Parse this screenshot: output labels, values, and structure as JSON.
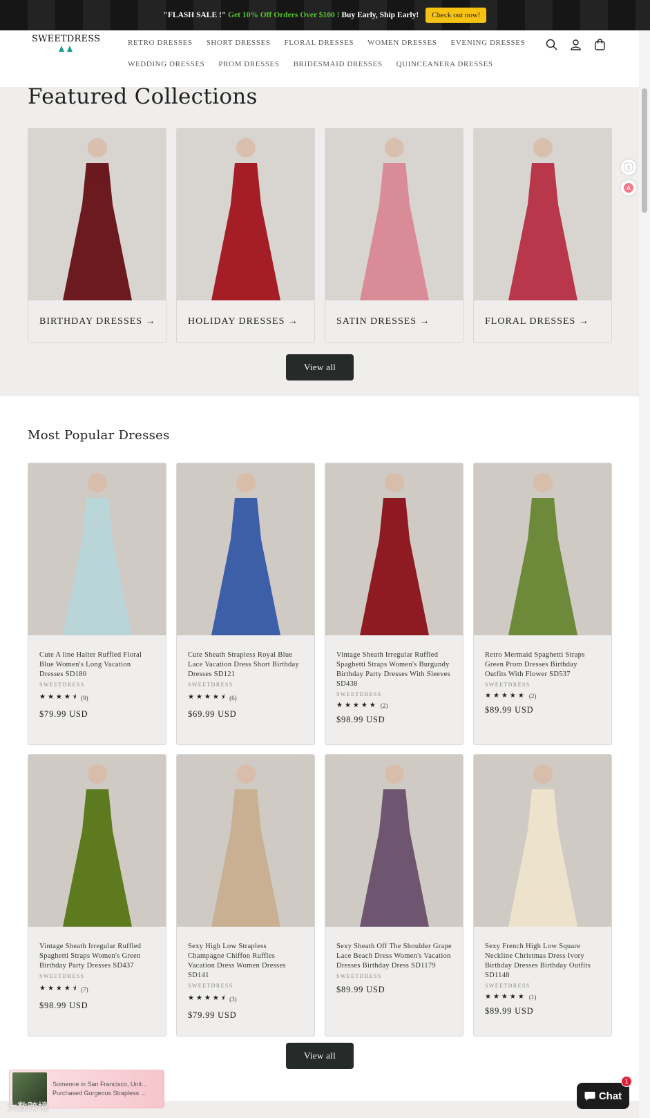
{
  "announcement": {
    "prefix": "\"FLASH SALE !\"",
    "highlight": "Get 10% Off Orders Over $100 !",
    "suffix": "Buy Early, Ship Early!",
    "button": "Check out now!"
  },
  "header": {
    "logo_text": "SWEETDRESS",
    "nav_row1": [
      "RETRO DRESSES",
      "SHORT DRESSES",
      "FLORAL DRESSES",
      "WOMEN DRESSES",
      "EVENING DRESSES"
    ],
    "nav_row2": [
      "WEDDING DRESSES",
      "PROM DRESSES",
      "BRIDESMAID DRESSES",
      "QUINCEANERA DRESSES"
    ],
    "icons": [
      "search-icon",
      "account-icon",
      "cart-icon"
    ]
  },
  "featured": {
    "title": "Featured Collections",
    "collections": [
      {
        "label": "BIRTHDAY DRESSES →",
        "color": "#6b1a1f"
      },
      {
        "label": "HOLIDAY DRESSES →",
        "color": "#a51e26"
      },
      {
        "label": "SATIN DRESSES →",
        "color": "#d98c98"
      },
      {
        "label": "FLORAL DRESSES →",
        "color": "#b8374a"
      }
    ],
    "view_all": "View all"
  },
  "popular": {
    "title": "Most Popular Dresses",
    "products": [
      {
        "title": "Cute A line Halter Ruffled Floral Blue Women's Long Vacation Dresses SD180",
        "vendor": "SWEETDRESS",
        "stars": "★★★★⯨",
        "count": "(9)",
        "price": "$79.99 USD",
        "color": "#b9d5d8"
      },
      {
        "title": "Cute Sheath Strapless Royal Blue Lace Vacation Dress Short Birthday Dresses SD121",
        "vendor": "SWEETDRESS",
        "stars": "★★★★⯨",
        "count": "(6)",
        "price": "$69.99 USD",
        "color": "#3c5fa8"
      },
      {
        "title": "Vintage Sheath Irregular Ruffled Spaghetti Straps Women's Burgundy Birthday Party Dresses With Sleeves SD438",
        "vendor": "SWEETDRESS",
        "stars": "★★★★★",
        "count": "(2)",
        "price": "$98.99 USD",
        "color": "#8e1a22"
      },
      {
        "title": "Retro Mermaid Spaghetti Straps Green Prom Dresses Birthday Outfits With Flower SD537",
        "vendor": "SWEETDRESS",
        "stars": "★★★★★",
        "count": "(2)",
        "price": "$89.99 USD",
        "color": "#6d8a3a"
      },
      {
        "title": "Vintage Sheath Irregular Ruffled Spaghetti Straps Women's Green Birthday Party Dresses SD437",
        "vendor": "SWEETDRESS",
        "stars": "★★★★⯨",
        "count": "(7)",
        "price": "$98.99 USD",
        "color": "#5d7a1f"
      },
      {
        "title": "Sexy High Low Strapless Champagne Chiffon Ruffles Vacation Dress Women Dresses SD141",
        "vendor": "SWEETDRESS",
        "stars": "★★★★⯨",
        "count": "(3)",
        "price": "$79.99 USD",
        "color": "#c9b093"
      },
      {
        "title": "Sexy Sheath Off The Shoulder Grape Lace Beach Dress Women's Vacation Dresses Birthday Dress SD1179",
        "vendor": "SWEETDRESS",
        "stars": "",
        "count": "",
        "price": "$89.99 USD",
        "color": "#6e5670"
      },
      {
        "title": "Sexy French High Low Square Neckline Christmas Dress Ivory Birthday Dresses Birthday Outfits SD1148",
        "vendor": "SWEETDRESS",
        "stars": "★★★★★",
        "count": "(1)",
        "price": "$89.99 USD",
        "color": "#ede3cc"
      }
    ],
    "view_all": "View all"
  },
  "toast": {
    "line1": "Someone in San Francisco, Unit...",
    "line2": "Purchased Gorgeous Strapless ..."
  },
  "watermark": "大数跨境",
  "chat": {
    "label": "Chat",
    "badge": "1"
  }
}
